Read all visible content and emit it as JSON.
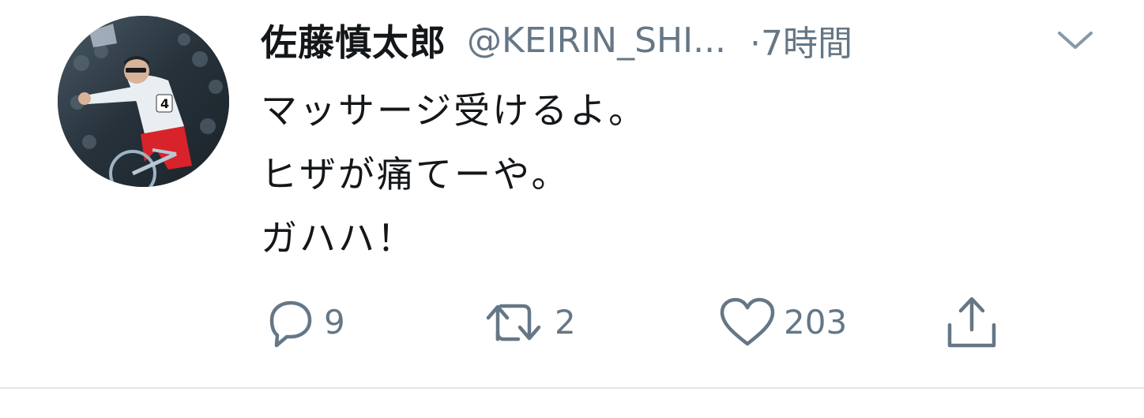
{
  "tweet": {
    "author": {
      "display_name": "佐藤慎太郎",
      "handle": "@KEIRIN_SHI...",
      "avatar": "avatar-photo-cyclist"
    },
    "separator": "·",
    "time": "7時間",
    "menu_icon": "chevron-down-icon",
    "lines": [
      "マッサージ受けるよ。",
      "ヒザが痛てーや。",
      "ガハハ！"
    ],
    "actions": {
      "reply": {
        "icon": "reply-icon",
        "count": "9"
      },
      "retweet": {
        "icon": "retweet-icon",
        "count": "2"
      },
      "like": {
        "icon": "heart-icon",
        "count": "203"
      },
      "share": {
        "icon": "share-icon"
      }
    }
  },
  "colors": {
    "text": "#14171a",
    "secondary": "#657786",
    "divider": "#e1e8ed"
  }
}
